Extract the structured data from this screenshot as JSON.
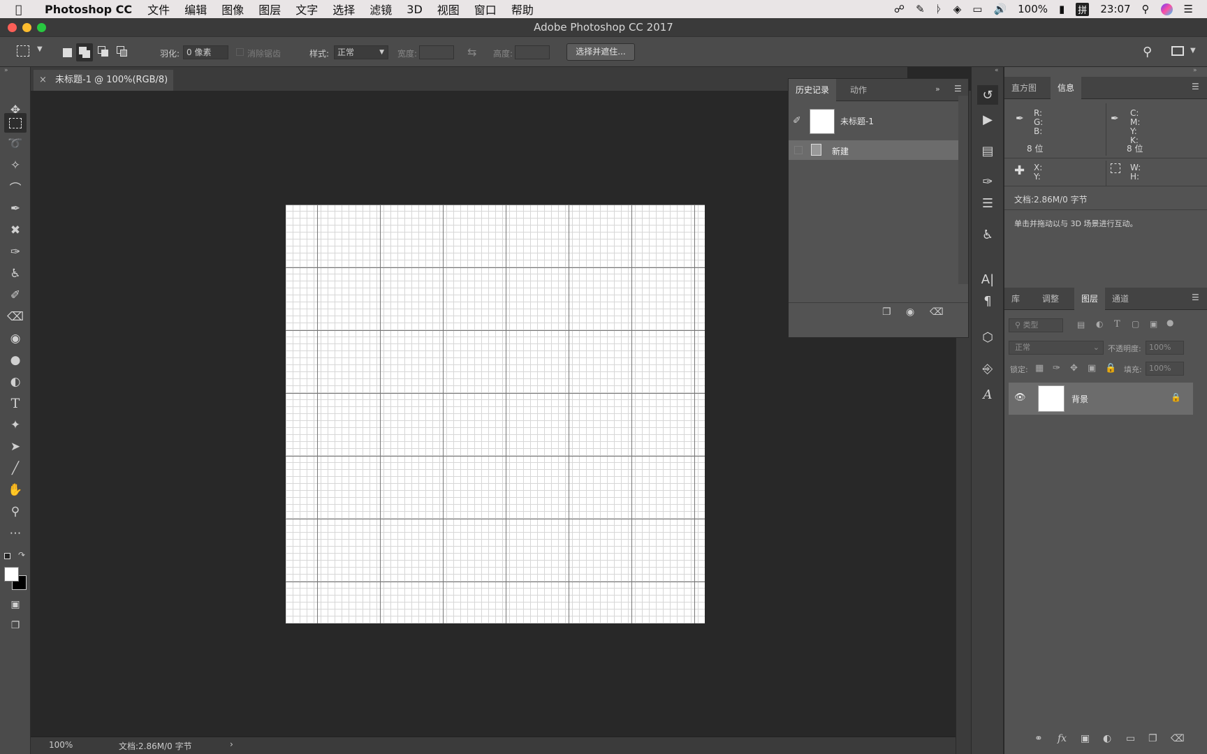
{
  "menubar": {
    "app_name": "Photoshop CC",
    "menus": [
      "文件",
      "编辑",
      "图像",
      "图层",
      "文字",
      "选择",
      "滤镜",
      "3D",
      "视图",
      "窗口",
      "帮助"
    ],
    "battery": "100%",
    "time": "23:07"
  },
  "window": {
    "title": "Adobe Photoshop CC 2017"
  },
  "options": {
    "feather_label": "羽化:",
    "feather_value": "0 像素",
    "antialias_label": "消除锯齿",
    "style_label": "样式:",
    "style_value": "正常",
    "width_label": "宽度:",
    "height_label": "高度:",
    "select_mask_button": "选择并遮住..."
  },
  "document": {
    "tab_title": "未标题-1 @ 100%(RGB/8)"
  },
  "status": {
    "zoom": "100%",
    "doc_info": "文档:2.86M/0 字节"
  },
  "history_panel": {
    "tabs": [
      "历史记录",
      "动作"
    ],
    "snapshot_name": "未标题-1",
    "steps": [
      "新建"
    ]
  },
  "info_panel": {
    "tabs": [
      "直方图",
      "信息"
    ],
    "rgb_labels": "R:\nG:\nB:",
    "cmyk_labels": "C:\nM:\nY:\nK:",
    "bit_left": "8 位",
    "bit_right": "8 位",
    "xy_labels": "X:\nY:",
    "wh_labels": "W:\nH:",
    "doc_info": "文档:2.86M/0 字节",
    "hint": "单击并拖动以与 3D 场景进行互动。"
  },
  "layers_panel": {
    "tabs": [
      "库",
      "调整",
      "图层",
      "通道"
    ],
    "filter_placeholder": "类型",
    "blend_mode": "正常",
    "opacity_label": "不透明度:",
    "opacity_value": "100%",
    "lock_label": "锁定:",
    "fill_label": "填充:",
    "fill_value": "100%",
    "layers": [
      {
        "name": "背景"
      }
    ]
  }
}
